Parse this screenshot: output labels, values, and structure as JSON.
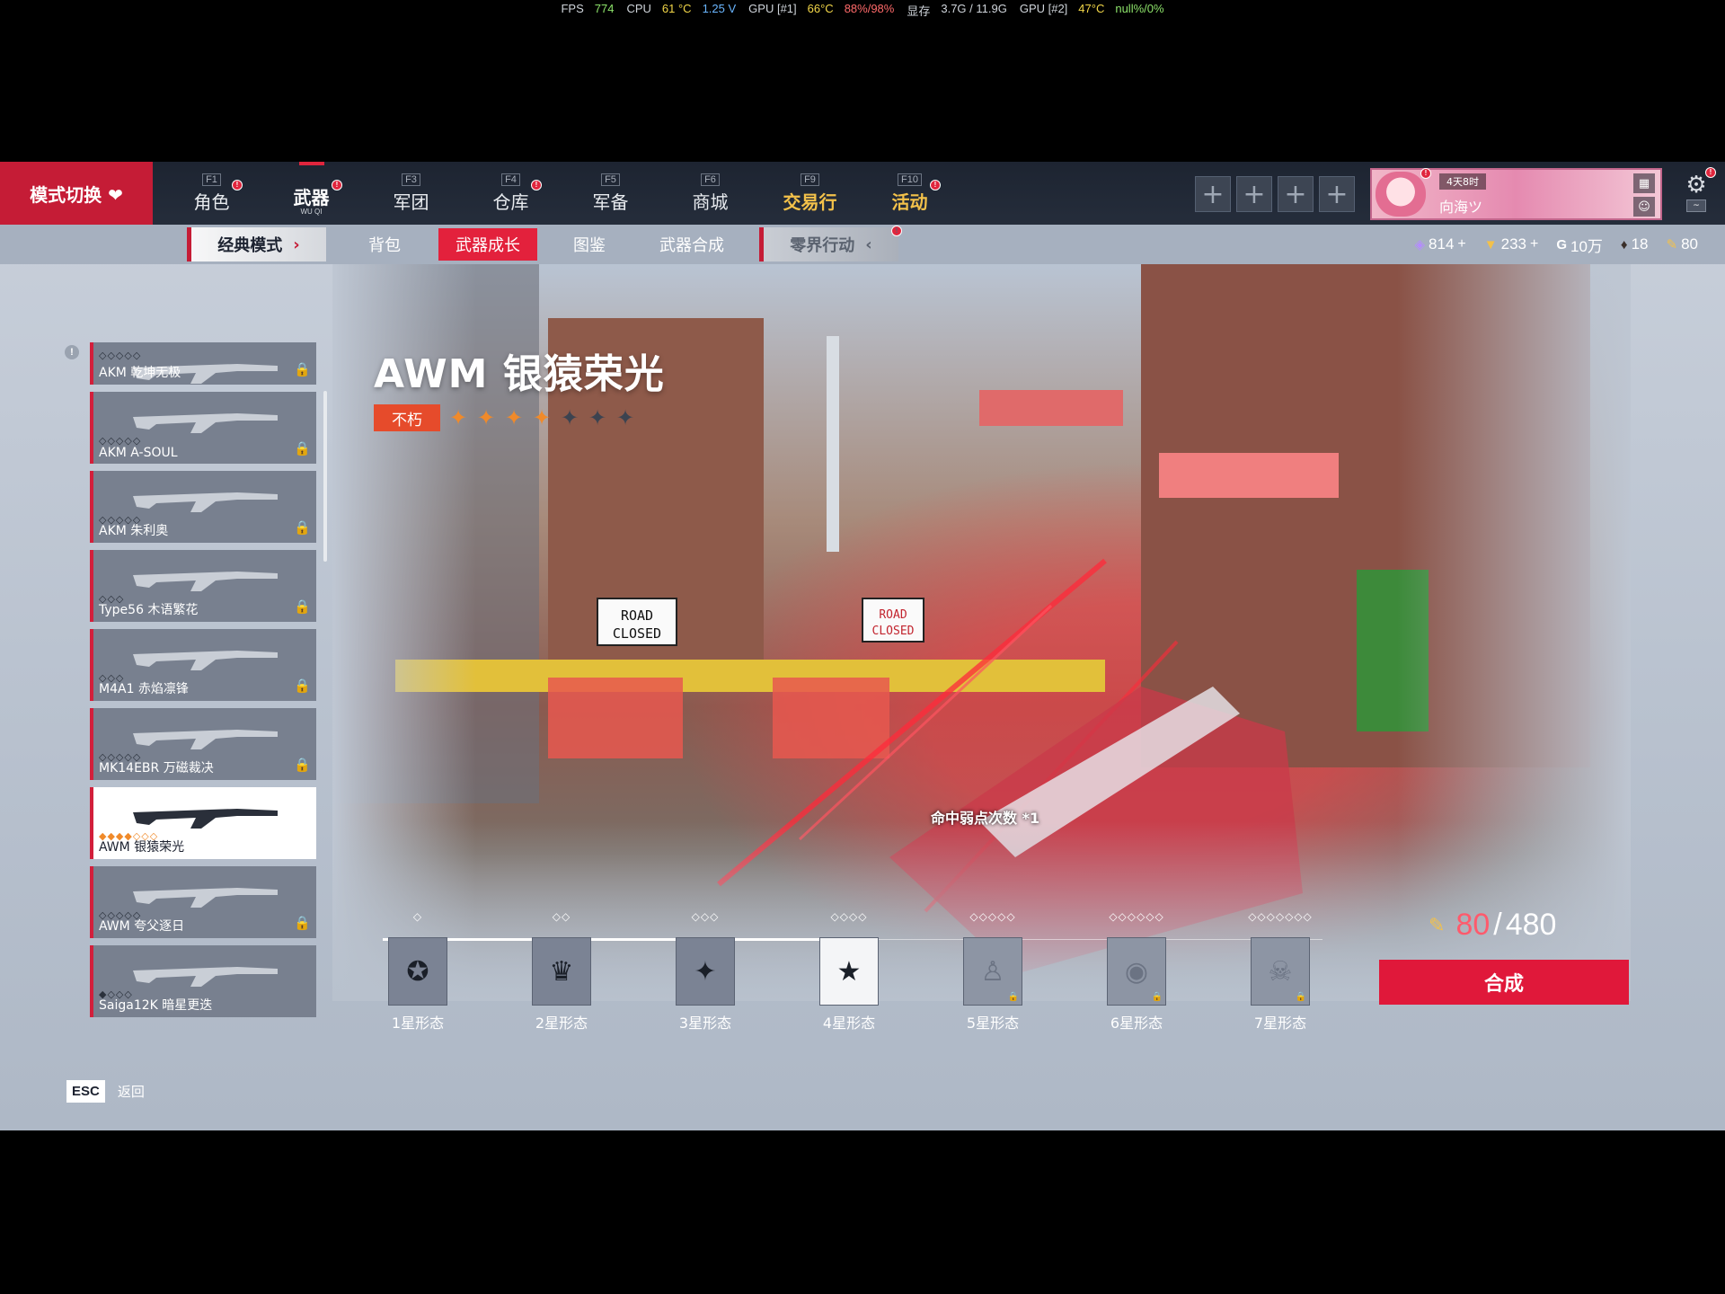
{
  "osd": {
    "fps_label": "FPS",
    "fps": "774",
    "cpu_label": "CPU",
    "cpu_temp": "61 °C",
    "cpu_volt": "1.25 V",
    "gpu1_label": "GPU [#1]",
    "gpu1_temp": "66°C",
    "gpu1_load": "88%/98%",
    "vram_label": "显存",
    "vram": "3.7G / 11.9G",
    "gpu2_label": "GPU [#2]",
    "gpu2_temp": "47°C",
    "gpu2_load": "null%/0%"
  },
  "topbar": {
    "mode_switch": "模式切换 ❤",
    "nav": [
      {
        "key": "F1",
        "label": "角色",
        "badge": "!"
      },
      {
        "key": "",
        "label": "武器",
        "sub": "WU QI",
        "badge": "!"
      },
      {
        "key": "F3",
        "label": "军团"
      },
      {
        "key": "F4",
        "label": "仓库",
        "badge": "!"
      },
      {
        "key": "F5",
        "label": "军备"
      },
      {
        "key": "F6",
        "label": "商城"
      },
      {
        "key": "F9",
        "label": "交易行"
      },
      {
        "key": "F10",
        "label": "活动",
        "badge": "!"
      }
    ],
    "plus": "+",
    "profile": {
      "timer": "4天8时",
      "name": "向海ツ",
      "badge": "!"
    },
    "settings_badge": "!"
  },
  "subtabs": {
    "classic": "经典模式",
    "bag": "背包",
    "growth": "武器成长",
    "codex": "图鉴",
    "synth": "武器合成",
    "zero": "零界行动"
  },
  "currency": [
    {
      "icon": "purple-gem-icon",
      "glyph": "◈",
      "value": "814",
      "plus": "+"
    },
    {
      "icon": "gold-bar-icon",
      "glyph": "▼",
      "value": "233",
      "plus": "+"
    },
    {
      "icon": "coin-g-icon",
      "glyph": "G",
      "value": "10万"
    },
    {
      "icon": "shield-token-icon",
      "glyph": "♦",
      "value": "18"
    },
    {
      "icon": "material-icon",
      "glyph": "✎",
      "value": "80"
    }
  ],
  "weapon": {
    "title": "AWM 银猿荣光",
    "rank": "不朽",
    "stars_total": 7,
    "stars_filled": 4
  },
  "hit_text": "命中弱点次数 *1",
  "weapon_list": [
    {
      "name": "AKM 乾坤无极",
      "stars": "◇◇◇◇◇",
      "locked": true
    },
    {
      "name": "AKM A-SOUL",
      "stars": "◇◇◇◇◇",
      "locked": true
    },
    {
      "name": "AKM 朱利奥",
      "stars": "◇◇◇◇◇",
      "locked": true
    },
    {
      "name": "Type56 木语繁花",
      "stars": "◇◇◇",
      "locked": true
    },
    {
      "name": "M4A1 赤焰凛锋",
      "stars": "◇◇◇",
      "locked": true
    },
    {
      "name": "MK14EBR 万磁裁决",
      "stars": "◇◇◇◇◇",
      "locked": true
    },
    {
      "name": "AWM 银猿荣光",
      "stars": "◆◆◆◆◇◇◇",
      "locked": false,
      "selected": true
    },
    {
      "name": "AWM 夸父逐日",
      "stars": "◇◇◇◇◇",
      "locked": true
    },
    {
      "name": "Saiga12K 暗星更迭",
      "stars": "◆◇◇◇",
      "locked": false
    }
  ],
  "stages": [
    {
      "label": "1星形态",
      "pips": "◇",
      "icon": "ribbon-medal-icon",
      "glyph": "✪",
      "state": "unlocked"
    },
    {
      "label": "2星形态",
      "pips": "◇◇",
      "icon": "horn-emblem-icon",
      "glyph": "♛",
      "state": "unlocked"
    },
    {
      "label": "3星形态",
      "pips": "◇◇◇",
      "icon": "wing-emblem-icon",
      "glyph": "✦",
      "state": "unlocked"
    },
    {
      "label": "4星形态",
      "pips": "◇◇◇◇",
      "icon": "star-diamond-icon",
      "glyph": "★",
      "state": "current"
    },
    {
      "label": "5星形态",
      "pips": "◇◇◇◇◇",
      "icon": "figure-icon",
      "glyph": "♙",
      "state": "locked"
    },
    {
      "label": "6星形态",
      "pips": "◇◇◇◇◇◇",
      "icon": "eye-icon",
      "glyph": "◉",
      "state": "locked"
    },
    {
      "label": "7星形态",
      "pips": "◇◇◇◇◇◇◇",
      "icon": "skull-emblem-icon",
      "glyph": "☠",
      "state": "locked"
    }
  ],
  "progress": {
    "current": "80",
    "slash": "/",
    "total": "480",
    "fraction": 0.1667
  },
  "synth_button": "合成",
  "esc": {
    "key": "ESC",
    "label": "返回"
  },
  "colors": {
    "accent": "#e0183a",
    "gold": "#f3c14a",
    "star": "#f08a2a"
  }
}
